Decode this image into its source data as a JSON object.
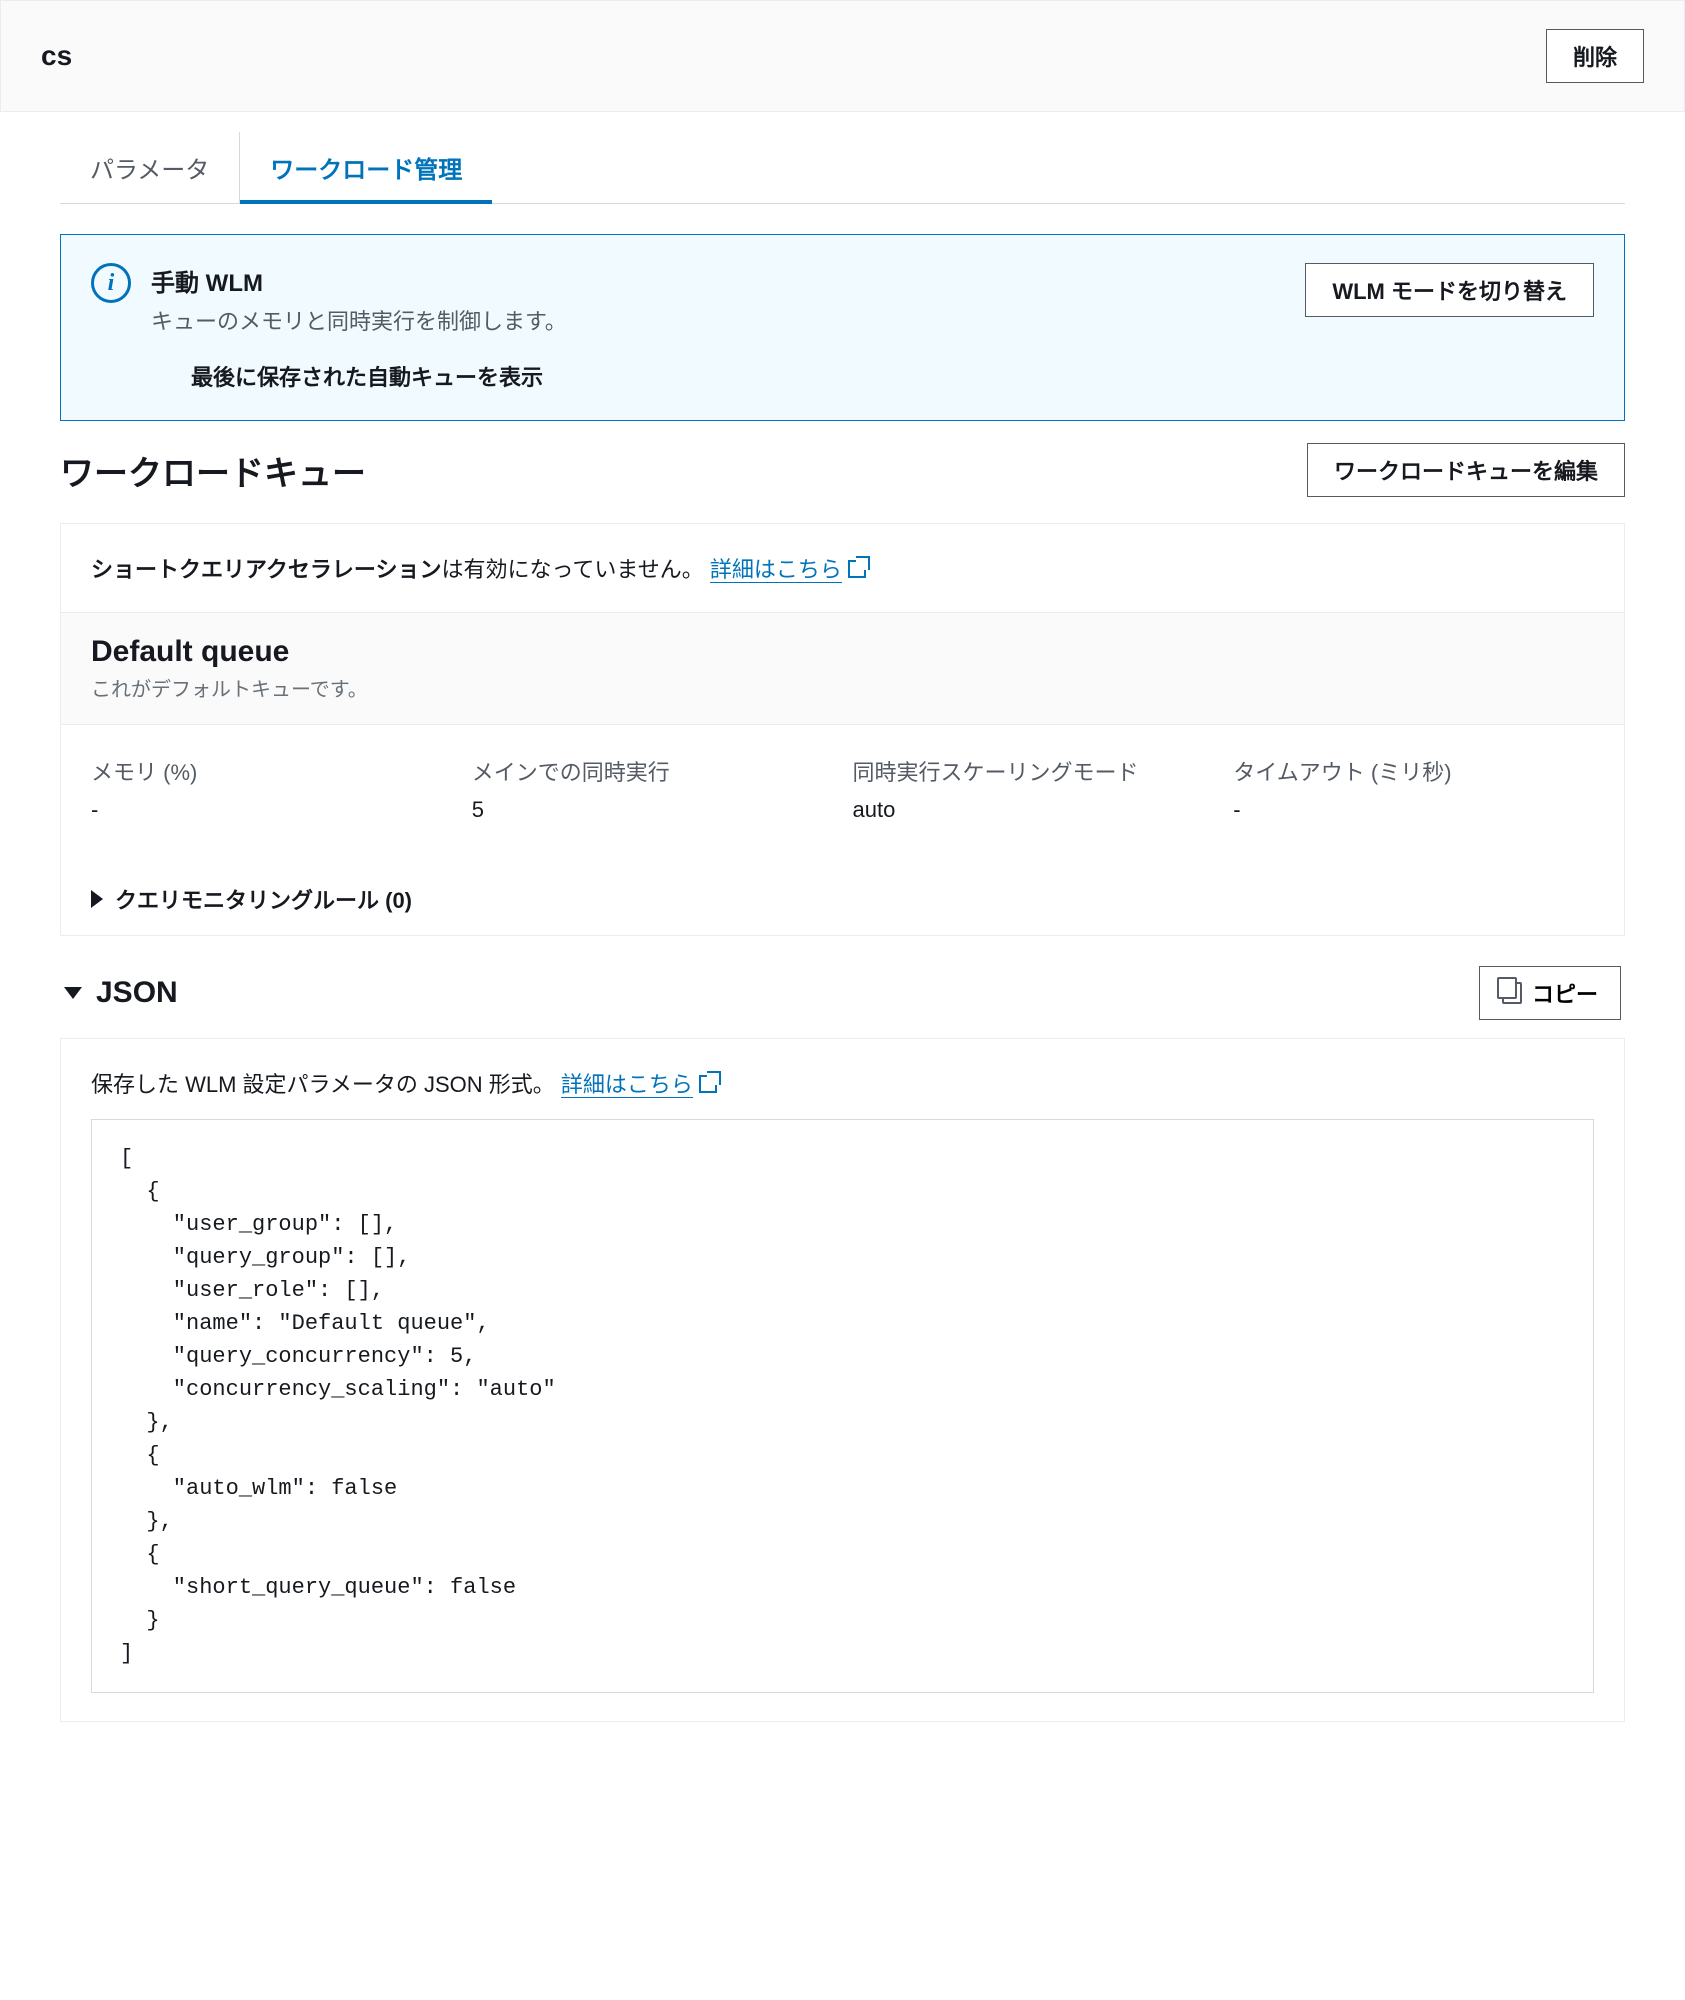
{
  "header": {
    "title": "cs",
    "delete_label": "削除"
  },
  "tabs": {
    "parameter": "パラメータ",
    "wlm": "ワークロード管理"
  },
  "info_panel": {
    "title": "手動 WLM",
    "description": "キューのメモリと同時実行を制御します。",
    "sub": "最後に保存された自動キューを表示",
    "switch_button": "WLM モードを切り替え"
  },
  "workload_section": {
    "title": "ワークロードキュー",
    "edit_button": "ワークロードキューを編集"
  },
  "sqa": {
    "bold": "ショートクエリアクセラレーション",
    "rest": "は有効になっていません。",
    "link": "詳細はこちら"
  },
  "default_queue": {
    "title": "Default queue",
    "subtitle": "これがデフォルトキューです。",
    "fields": {
      "memory_label": "メモリ (%)",
      "memory_value": "-",
      "concurrency_label": "メインでの同時実行",
      "concurrency_value": "5",
      "scaling_label": "同時実行スケーリングモード",
      "scaling_value": "auto",
      "timeout_label": "タイムアウト (ミリ秒)",
      "timeout_value": "-"
    }
  },
  "qmr": {
    "label": "クエリモニタリングルール (0)"
  },
  "json_section": {
    "title": "JSON",
    "copy_label": "コピー",
    "description": "保存した WLM 設定パラメータの JSON 形式。",
    "link": "詳細はこちら",
    "code": "[\n  {\n    \"user_group\": [],\n    \"query_group\": [],\n    \"user_role\": [],\n    \"name\": \"Default queue\",\n    \"query_concurrency\": 5,\n    \"concurrency_scaling\": \"auto\"\n  },\n  {\n    \"auto_wlm\": false\n  },\n  {\n    \"short_query_queue\": false\n  }\n]"
  }
}
